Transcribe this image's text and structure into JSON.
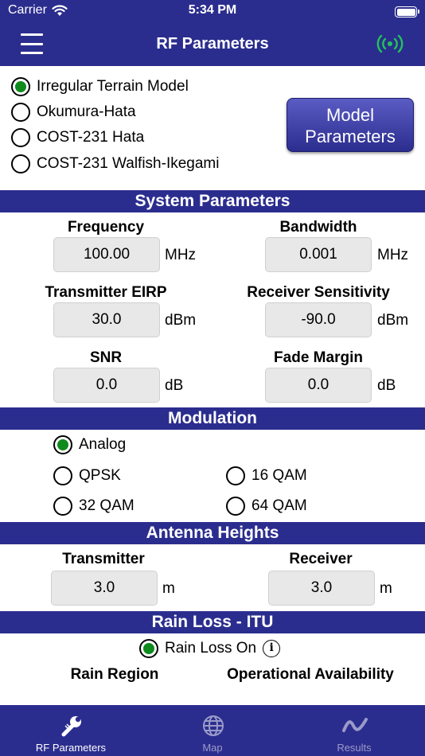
{
  "status_bar": {
    "carrier": "Carrier",
    "time": "5:34 PM"
  },
  "nav": {
    "title": "RF Parameters"
  },
  "models": {
    "options": [
      {
        "label": "Irregular Terrain Model",
        "selected": true
      },
      {
        "label": "Okumura-Hata",
        "selected": false
      },
      {
        "label": "COST-231 Hata",
        "selected": false
      },
      {
        "label": "COST-231 Walfish-Ikegami",
        "selected": false
      }
    ],
    "params_button_line1": "Model",
    "params_button_line2": "Parameters"
  },
  "system": {
    "header": "System Parameters",
    "frequency": {
      "label": "Frequency",
      "value": "100.00",
      "unit": "MHz"
    },
    "bandwidth": {
      "label": "Bandwidth",
      "value": "0.001",
      "unit": "MHz"
    },
    "eirp": {
      "label": "Transmitter EIRP",
      "value": "30.0",
      "unit": "dBm"
    },
    "sensitivity": {
      "label": "Receiver Sensitivity",
      "value": "-90.0",
      "unit": "dBm"
    },
    "snr": {
      "label": "SNR",
      "value": "0.0",
      "unit": "dB"
    },
    "fade": {
      "label": "Fade Margin",
      "value": "0.0",
      "unit": "dB"
    }
  },
  "modulation": {
    "header": "Modulation",
    "analog": "Analog",
    "qpsk": "QPSK",
    "qam16": "16 QAM",
    "qam32": "32 QAM",
    "qam64": "64 QAM",
    "selected": "Analog"
  },
  "antenna": {
    "header": "Antenna Heights",
    "tx": {
      "label": "Transmitter",
      "value": "3.0",
      "unit": "m"
    },
    "rx": {
      "label": "Receiver",
      "value": "3.0",
      "unit": "m"
    }
  },
  "rain": {
    "header": "Rain Loss - ITU",
    "toggle_label": "Rain Loss On",
    "toggle_on": true,
    "info_glyph": "i",
    "region_label": "Rain Region",
    "availability_label": "Operational Availability"
  },
  "tabs": [
    {
      "label": "RF Parameters",
      "active": true,
      "icon": "wrench-icon"
    },
    {
      "label": "Map",
      "active": false,
      "icon": "globe-icon"
    },
    {
      "label": "Results",
      "active": false,
      "icon": "waveform-icon"
    }
  ],
  "colors": {
    "brand": "#2b2d8e",
    "selected_radio": "#0f8a1c",
    "signal_icon": "#22c35a",
    "active_tab": "#ffffff",
    "inactive_tab": "#9a9bc9"
  }
}
